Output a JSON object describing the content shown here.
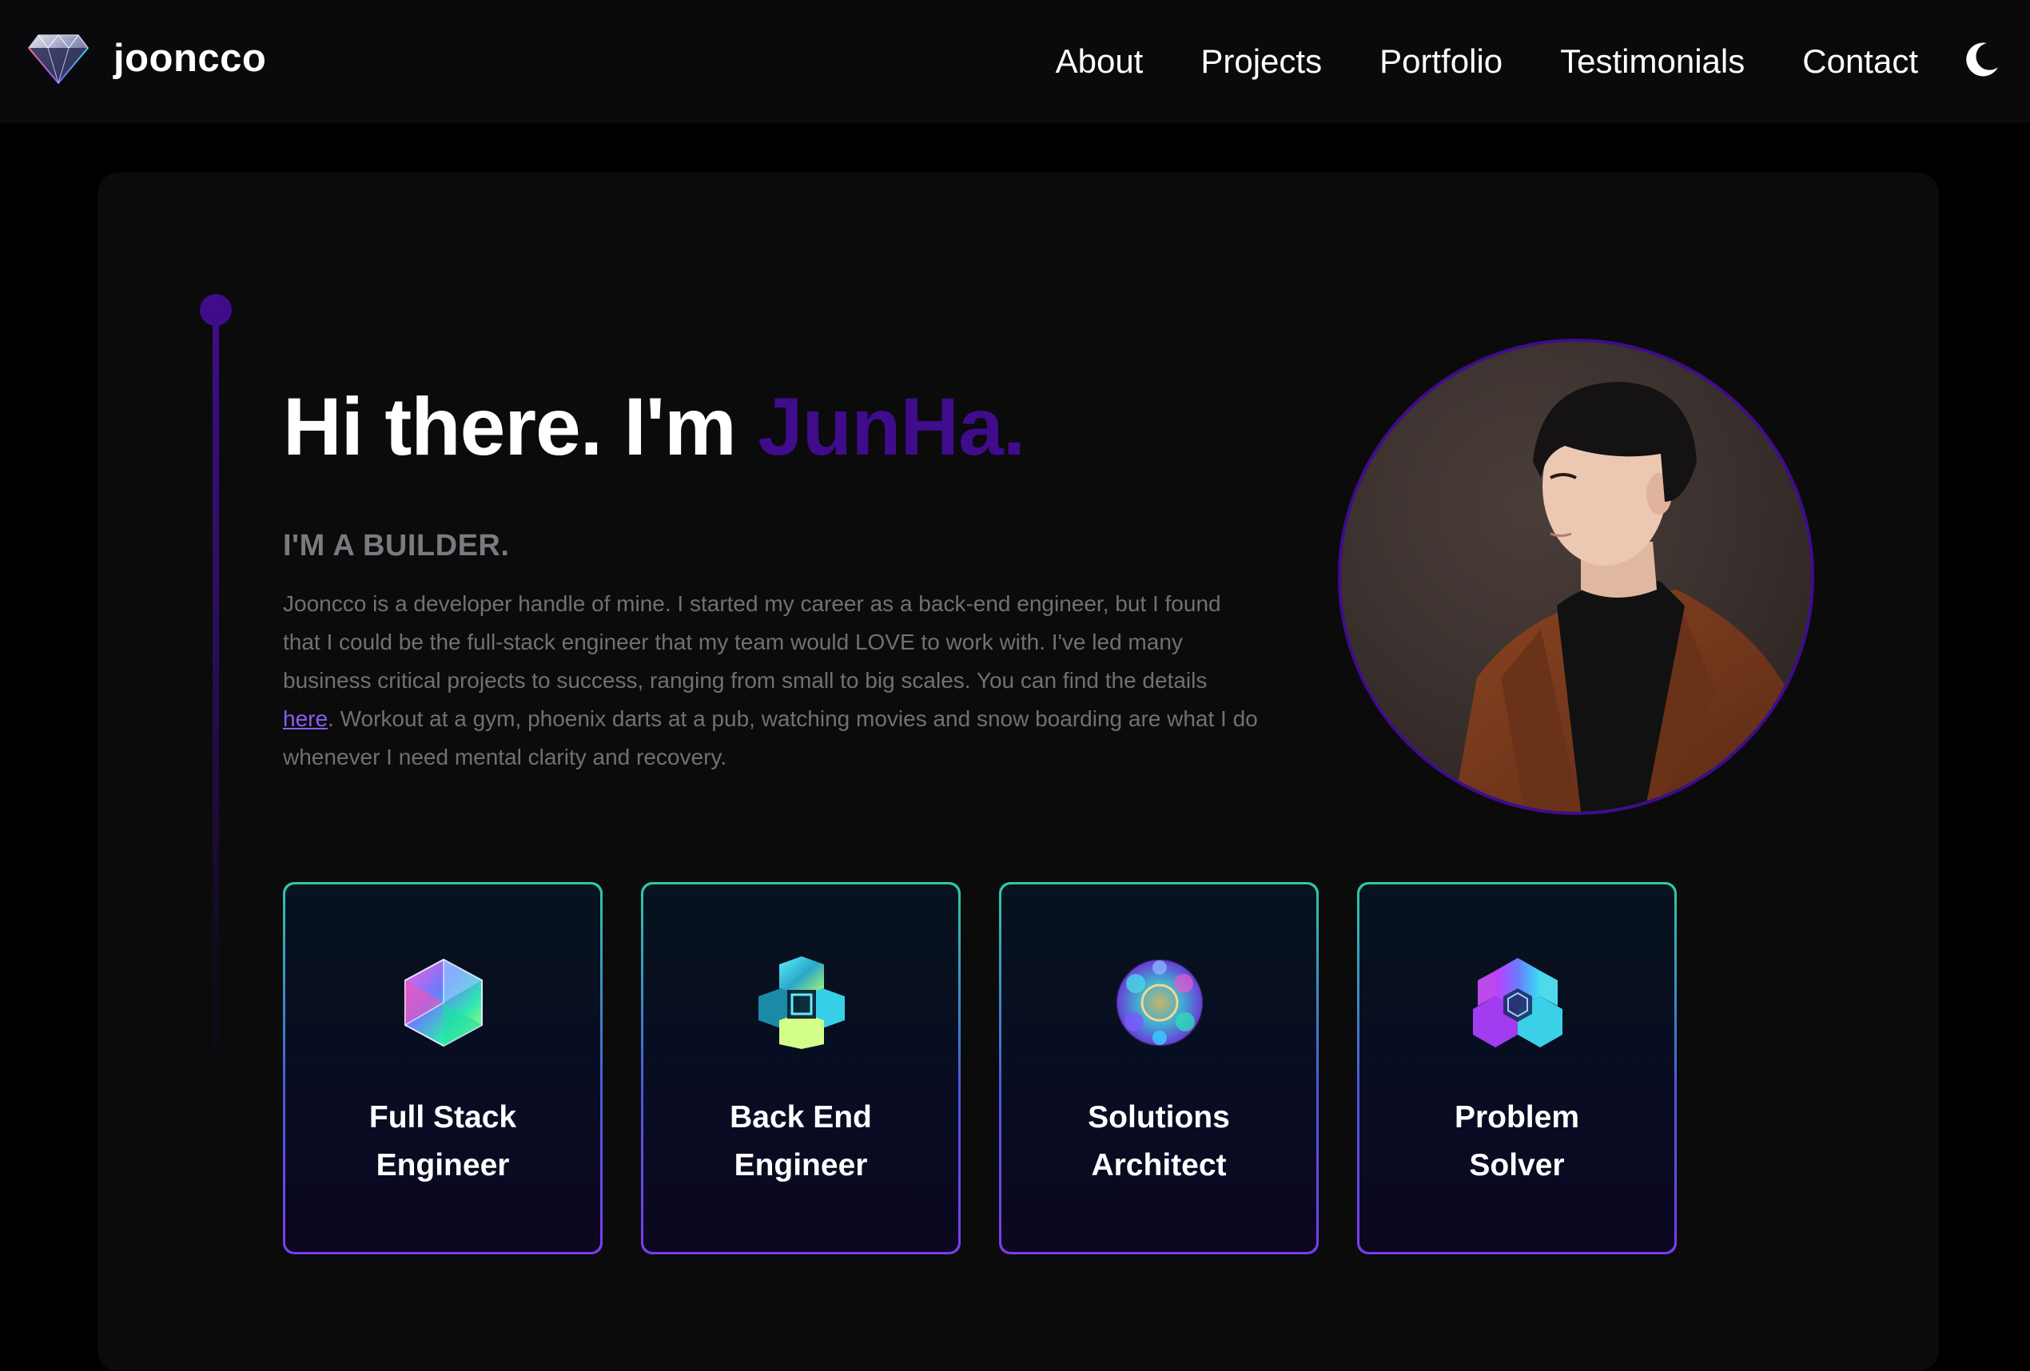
{
  "brand": {
    "name": "jooncco",
    "logo_icon": "diamond-icon"
  },
  "nav": {
    "items": [
      {
        "label": "About"
      },
      {
        "label": "Projects"
      },
      {
        "label": "Portfolio"
      },
      {
        "label": "Testimonials"
      },
      {
        "label": "Contact"
      }
    ],
    "theme_toggle_icon": "moon-icon"
  },
  "hero": {
    "greeting": "Hi there. I'm ",
    "name": "JunHa.",
    "subtitle": "I'M A BUILDER.",
    "bio_before_link": "Jooncco is a developer handle of mine. I started my career as a back-end engineer, but I found that I could be the full-stack engineer that my team would LOVE to work with. I've led many business critical projects to success, ranging from small to big scales. You can find the details ",
    "bio_link": "here",
    "bio_after_link": ". Workout at a gym, phoenix darts at a pub, watching movies and snow boarding are what I do whenever I need mental clarity and recovery.",
    "avatar_icon": "profile-photo"
  },
  "roles": [
    {
      "label": "Full Stack\nEngineer",
      "icon": "icosahedron-icon"
    },
    {
      "label": "Back End\nEngineer",
      "icon": "cube-lattice-icon"
    },
    {
      "label": "Solutions\nArchitect",
      "icon": "sphere-cluster-icon"
    },
    {
      "label": "Problem\nSolver",
      "icon": "hexagon-cluster-icon"
    }
  ],
  "colors": {
    "accent_purple": "#3f0c8c",
    "link_purple": "#8b5cf6",
    "card_border_top": "#2ec9a6",
    "card_border_bottom": "#7a3cf0",
    "navbar_bg": "#0a0a0c",
    "page_bg": "#000000",
    "panel_bg": "#0b0b0b"
  }
}
